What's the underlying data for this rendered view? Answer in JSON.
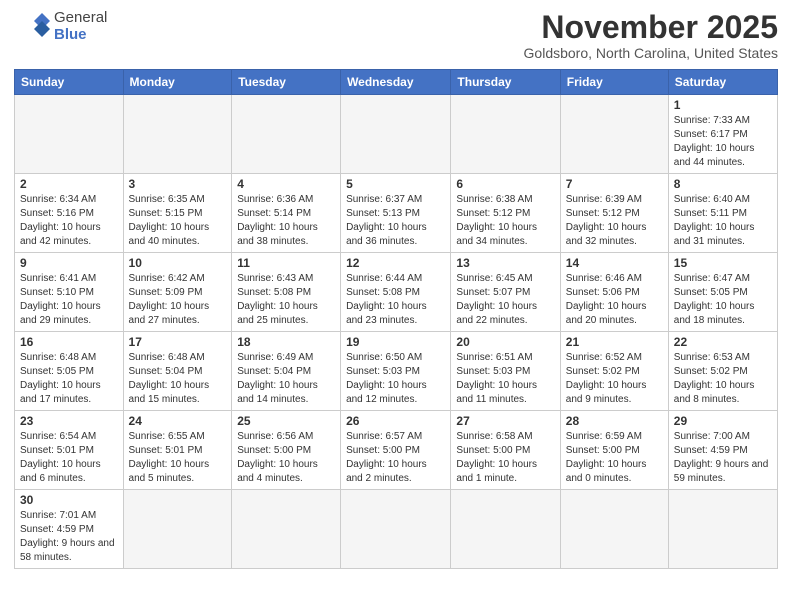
{
  "header": {
    "logo_general": "General",
    "logo_blue": "Blue",
    "month_title": "November 2025",
    "location": "Goldsboro, North Carolina, United States"
  },
  "weekdays": [
    "Sunday",
    "Monday",
    "Tuesday",
    "Wednesday",
    "Thursday",
    "Friday",
    "Saturday"
  ],
  "weeks": [
    [
      {
        "day": "",
        "info": ""
      },
      {
        "day": "",
        "info": ""
      },
      {
        "day": "",
        "info": ""
      },
      {
        "day": "",
        "info": ""
      },
      {
        "day": "",
        "info": ""
      },
      {
        "day": "",
        "info": ""
      },
      {
        "day": "1",
        "info": "Sunrise: 7:33 AM\nSunset: 6:17 PM\nDaylight: 10 hours and 44 minutes."
      }
    ],
    [
      {
        "day": "2",
        "info": "Sunrise: 6:34 AM\nSunset: 5:16 PM\nDaylight: 10 hours and 42 minutes."
      },
      {
        "day": "3",
        "info": "Sunrise: 6:35 AM\nSunset: 5:15 PM\nDaylight: 10 hours and 40 minutes."
      },
      {
        "day": "4",
        "info": "Sunrise: 6:36 AM\nSunset: 5:14 PM\nDaylight: 10 hours and 38 minutes."
      },
      {
        "day": "5",
        "info": "Sunrise: 6:37 AM\nSunset: 5:13 PM\nDaylight: 10 hours and 36 minutes."
      },
      {
        "day": "6",
        "info": "Sunrise: 6:38 AM\nSunset: 5:12 PM\nDaylight: 10 hours and 34 minutes."
      },
      {
        "day": "7",
        "info": "Sunrise: 6:39 AM\nSunset: 5:12 PM\nDaylight: 10 hours and 32 minutes."
      },
      {
        "day": "8",
        "info": "Sunrise: 6:40 AM\nSunset: 5:11 PM\nDaylight: 10 hours and 31 minutes."
      }
    ],
    [
      {
        "day": "9",
        "info": "Sunrise: 6:41 AM\nSunset: 5:10 PM\nDaylight: 10 hours and 29 minutes."
      },
      {
        "day": "10",
        "info": "Sunrise: 6:42 AM\nSunset: 5:09 PM\nDaylight: 10 hours and 27 minutes."
      },
      {
        "day": "11",
        "info": "Sunrise: 6:43 AM\nSunset: 5:08 PM\nDaylight: 10 hours and 25 minutes."
      },
      {
        "day": "12",
        "info": "Sunrise: 6:44 AM\nSunset: 5:08 PM\nDaylight: 10 hours and 23 minutes."
      },
      {
        "day": "13",
        "info": "Sunrise: 6:45 AM\nSunset: 5:07 PM\nDaylight: 10 hours and 22 minutes."
      },
      {
        "day": "14",
        "info": "Sunrise: 6:46 AM\nSunset: 5:06 PM\nDaylight: 10 hours and 20 minutes."
      },
      {
        "day": "15",
        "info": "Sunrise: 6:47 AM\nSunset: 5:05 PM\nDaylight: 10 hours and 18 minutes."
      }
    ],
    [
      {
        "day": "16",
        "info": "Sunrise: 6:48 AM\nSunset: 5:05 PM\nDaylight: 10 hours and 17 minutes."
      },
      {
        "day": "17",
        "info": "Sunrise: 6:48 AM\nSunset: 5:04 PM\nDaylight: 10 hours and 15 minutes."
      },
      {
        "day": "18",
        "info": "Sunrise: 6:49 AM\nSunset: 5:04 PM\nDaylight: 10 hours and 14 minutes."
      },
      {
        "day": "19",
        "info": "Sunrise: 6:50 AM\nSunset: 5:03 PM\nDaylight: 10 hours and 12 minutes."
      },
      {
        "day": "20",
        "info": "Sunrise: 6:51 AM\nSunset: 5:03 PM\nDaylight: 10 hours and 11 minutes."
      },
      {
        "day": "21",
        "info": "Sunrise: 6:52 AM\nSunset: 5:02 PM\nDaylight: 10 hours and 9 minutes."
      },
      {
        "day": "22",
        "info": "Sunrise: 6:53 AM\nSunset: 5:02 PM\nDaylight: 10 hours and 8 minutes."
      }
    ],
    [
      {
        "day": "23",
        "info": "Sunrise: 6:54 AM\nSunset: 5:01 PM\nDaylight: 10 hours and 6 minutes."
      },
      {
        "day": "24",
        "info": "Sunrise: 6:55 AM\nSunset: 5:01 PM\nDaylight: 10 hours and 5 minutes."
      },
      {
        "day": "25",
        "info": "Sunrise: 6:56 AM\nSunset: 5:00 PM\nDaylight: 10 hours and 4 minutes."
      },
      {
        "day": "26",
        "info": "Sunrise: 6:57 AM\nSunset: 5:00 PM\nDaylight: 10 hours and 2 minutes."
      },
      {
        "day": "27",
        "info": "Sunrise: 6:58 AM\nSunset: 5:00 PM\nDaylight: 10 hours and 1 minute."
      },
      {
        "day": "28",
        "info": "Sunrise: 6:59 AM\nSunset: 5:00 PM\nDaylight: 10 hours and 0 minutes."
      },
      {
        "day": "29",
        "info": "Sunrise: 7:00 AM\nSunset: 4:59 PM\nDaylight: 9 hours and 59 minutes."
      }
    ],
    [
      {
        "day": "30",
        "info": "Sunrise: 7:01 AM\nSunset: 4:59 PM\nDaylight: 9 hours and 58 minutes."
      },
      {
        "day": "",
        "info": ""
      },
      {
        "day": "",
        "info": ""
      },
      {
        "day": "",
        "info": ""
      },
      {
        "day": "",
        "info": ""
      },
      {
        "day": "",
        "info": ""
      },
      {
        "day": "",
        "info": ""
      }
    ]
  ]
}
